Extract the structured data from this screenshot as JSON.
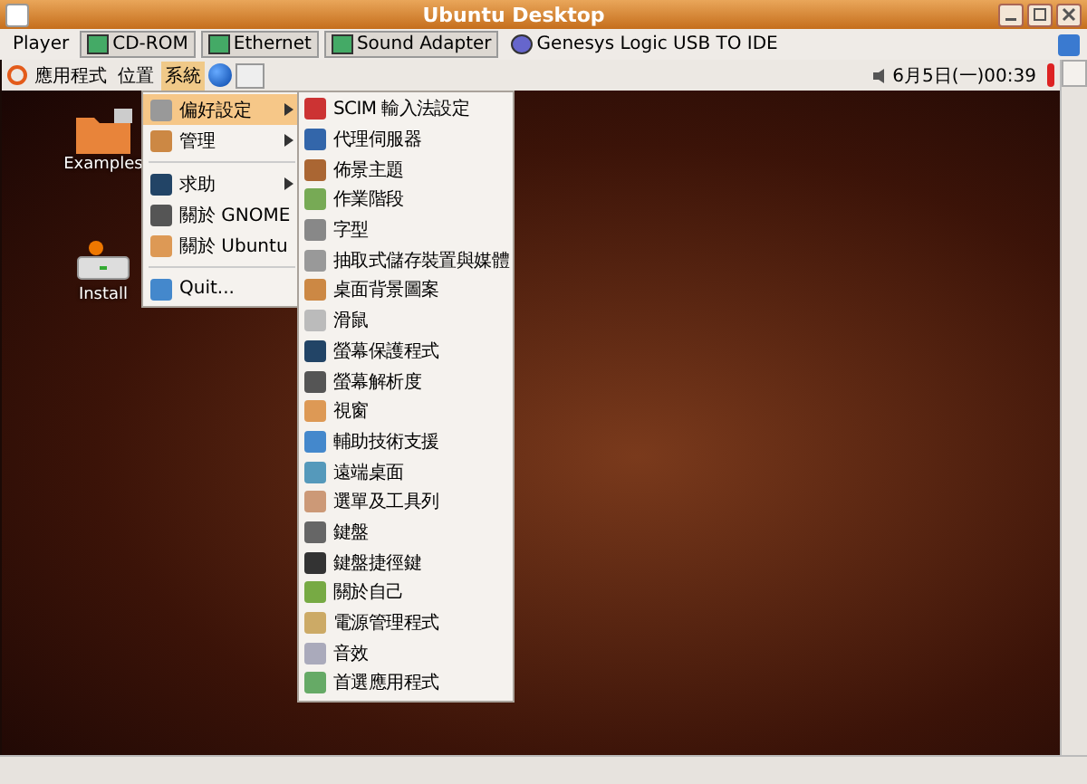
{
  "window": {
    "title": "Ubuntu Desktop"
  },
  "toolbar": {
    "items": [
      {
        "label": "Player",
        "kind": "menu"
      },
      {
        "label": "CD-ROM",
        "kind": "device",
        "active": true
      },
      {
        "label": "Ethernet",
        "kind": "device",
        "active": true
      },
      {
        "label": "Sound Adapter",
        "kind": "device",
        "active": true
      },
      {
        "label": "Genesys Logic USB TO IDE",
        "kind": "device",
        "active": false
      }
    ]
  },
  "panel": {
    "menus": [
      {
        "label": "應用程式",
        "selected": false
      },
      {
        "label": "位置",
        "selected": false
      },
      {
        "label": "系統",
        "selected": true
      }
    ],
    "clock": "6月5日(一)00:39"
  },
  "desktop_icons": [
    {
      "label": "Examples",
      "kind": "folder"
    },
    {
      "label": "Install",
      "kind": "drive"
    }
  ],
  "system_menu": {
    "groups": [
      [
        {
          "label": "偏好設定",
          "submenu": true,
          "selected": true
        },
        {
          "label": "管理",
          "submenu": true,
          "selected": false
        }
      ],
      [
        {
          "label": "求助",
          "submenu": true,
          "selected": false
        },
        {
          "label": "關於 GNOME",
          "submenu": false,
          "selected": false
        },
        {
          "label": "關於 Ubuntu",
          "submenu": false,
          "selected": false
        }
      ],
      [
        {
          "label": "Quit...",
          "submenu": false,
          "selected": false
        }
      ]
    ]
  },
  "preferences_menu": {
    "items": [
      "SCIM 輸入法設定",
      "代理伺服器",
      "佈景主題",
      "作業階段",
      "字型",
      "抽取式儲存裝置與媒體",
      "桌面背景圖案",
      "滑鼠",
      "螢幕保護程式",
      "螢幕解析度",
      "視窗",
      "輔助技術支援",
      "遠端桌面",
      "選單及工具列",
      "鍵盤",
      "鍵盤捷徑鍵",
      "關於自己",
      "電源管理程式",
      "音效",
      "首選應用程式"
    ]
  }
}
